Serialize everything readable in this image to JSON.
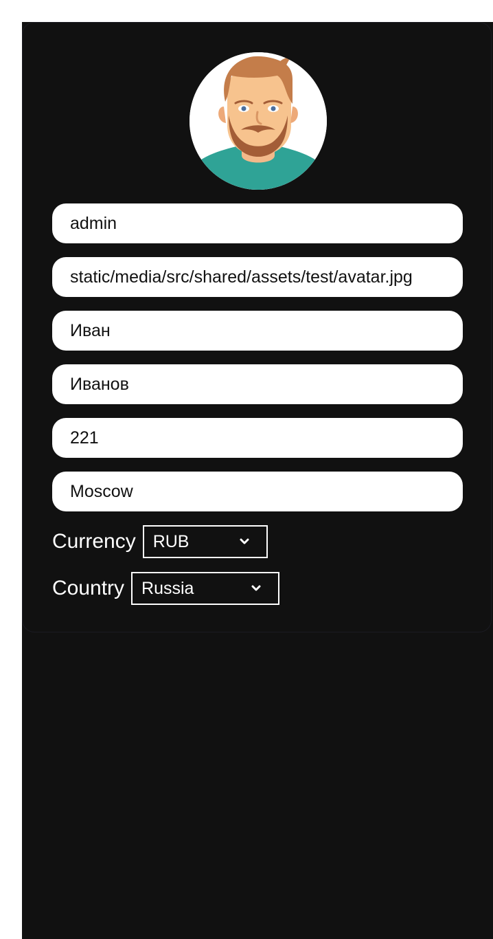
{
  "profile": {
    "avatar_icon": "avatar-illustration-icon",
    "fields": {
      "username": "admin",
      "avatar_path": "static/media/src/shared/assets/test/avatar.jpg",
      "first_name": "Иван",
      "last_name": "Иванов",
      "age": "221",
      "city": "Moscow"
    },
    "currency": {
      "label": "Currency",
      "value": "RUB",
      "icon": "chevron-down-icon"
    },
    "country": {
      "label": "Country",
      "value": "Russia",
      "icon": "chevron-down-icon"
    }
  },
  "colors": {
    "background": "#111111",
    "card": "#111111",
    "field": "#ffffff",
    "text_dark": "#111111",
    "text_light": "#ffffff",
    "avatar_shirt": "#2fa396",
    "avatar_skin": "#f7c38e",
    "avatar_hair": "#c47d4a",
    "avatar_beard": "#a35d37"
  }
}
